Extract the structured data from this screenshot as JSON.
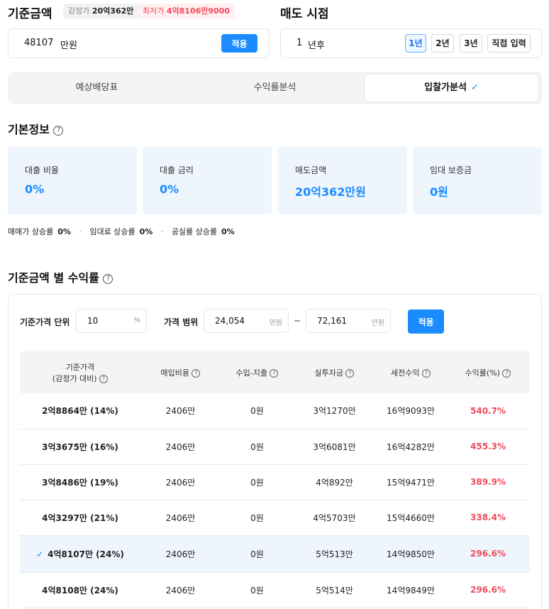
{
  "base": {
    "title": "기준금액",
    "appraisal_label": "감정가",
    "appraisal_value": "20억362만",
    "minimum_label": "최저가",
    "minimum_value": "4억8106만9000",
    "amount": "48107",
    "unit": "만원",
    "apply_label": "적용"
  },
  "sale": {
    "title": "매도 시점",
    "value": "1",
    "unit": "년후",
    "options": [
      "1년",
      "2년",
      "3년",
      "직접 입력"
    ],
    "selected": "1년"
  },
  "tabs": [
    {
      "label": "예상배당표",
      "active": false
    },
    {
      "label": "수익률분석",
      "active": false
    },
    {
      "label": "입찰가분석",
      "active": true,
      "check": "✓"
    }
  ],
  "basic": {
    "title": "기본정보",
    "cards": [
      {
        "label": "대출 비율",
        "value": "0%"
      },
      {
        "label": "대출 금리",
        "value": "0%"
      },
      {
        "label": "매도금액",
        "value": "20억362만원"
      },
      {
        "label": "임대 보증금",
        "value": "0원"
      }
    ],
    "rates": [
      {
        "label": "매매가 상승률",
        "value": "0%"
      },
      {
        "label": "임대료 상승률",
        "value": "0%"
      },
      {
        "label": "공실률 상승률",
        "value": "0%"
      }
    ],
    "separator": "·"
  },
  "returns": {
    "title": "기준금액 별 수익률",
    "unit_label": "기준가격 단위",
    "unit_value": "10",
    "unit_suffix": "%",
    "range_label": "가격 범위",
    "range_min": "24,054",
    "range_max": "72,161",
    "range_unit": "만원",
    "tilde": "~",
    "apply_label": "적용",
    "columns": [
      "기준가격\n(감정가 대비)",
      "매입비용",
      "수입-지출",
      "실투자금",
      "세전수익",
      "수익률(%)"
    ],
    "col_line1": "기준가격",
    "col_line2": "(감정가 대비)",
    "rows": [
      {
        "price": "2억8864만 (14%)",
        "cost": "2406만",
        "net": "0원",
        "invest": "3억1270만",
        "profit": "16억9093만",
        "rate": "540.7%",
        "selected": false
      },
      {
        "price": "3억3675만 (16%)",
        "cost": "2406만",
        "net": "0원",
        "invest": "3억6081만",
        "profit": "16억4282만",
        "rate": "455.3%",
        "selected": false
      },
      {
        "price": "3억8486만 (19%)",
        "cost": "2406만",
        "net": "0원",
        "invest": "4억892만",
        "profit": "15억9471만",
        "rate": "389.9%",
        "selected": false
      },
      {
        "price": "4억3297만 (21%)",
        "cost": "2406만",
        "net": "0원",
        "invest": "4억5703만",
        "profit": "15억4660만",
        "rate": "338.4%",
        "selected": false
      },
      {
        "price": "4억8107만 (24%)",
        "cost": "2406만",
        "net": "0원",
        "invest": "5억513만",
        "profit": "14억9850만",
        "rate": "296.6%",
        "selected": true
      },
      {
        "price": "4억8108만 (24%)",
        "cost": "2406만",
        "net": "0원",
        "invest": "5억514만",
        "profit": "14억9849만",
        "rate": "296.6%",
        "selected": false
      }
    ]
  },
  "colors": {
    "accent": "#1a8cff",
    "red": "#f04b5a",
    "card_bg": "#eef5fd"
  }
}
